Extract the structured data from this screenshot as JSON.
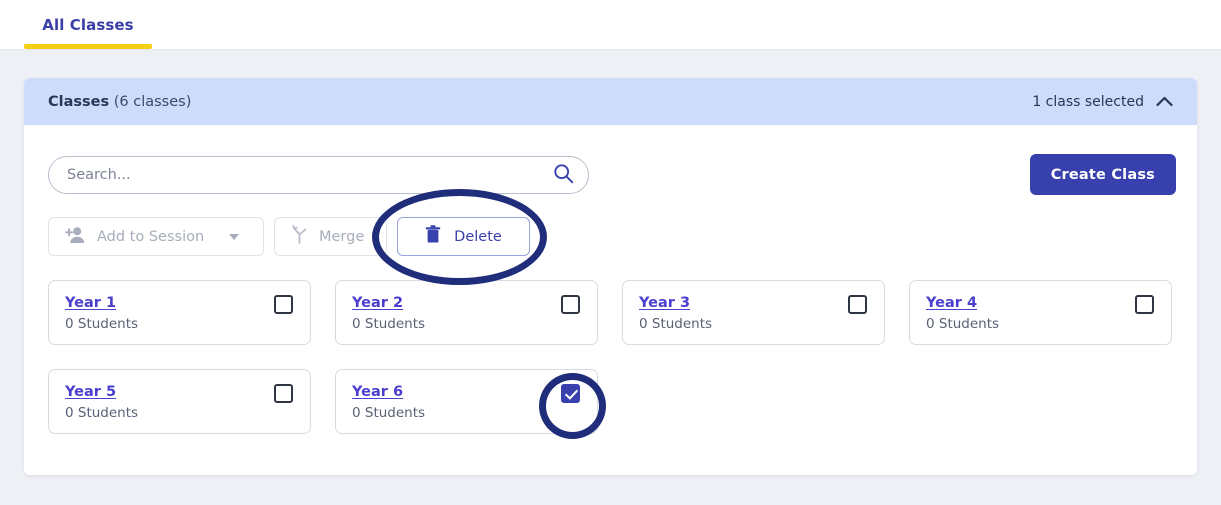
{
  "tabs": [
    {
      "label": "All Classes",
      "active": true
    }
  ],
  "panel": {
    "title": "Classes",
    "count_label": "(6 classes)",
    "selection_status": "1 class selected",
    "collapse_icon": "chevron-up-icon"
  },
  "search": {
    "placeholder": "Search...",
    "value": "",
    "icon": "search-icon"
  },
  "create_button": {
    "label": "Create Class"
  },
  "toolbar": {
    "add_to_session": {
      "label": "Add to Session",
      "icon": "person-add-icon",
      "caret": "caret-down-icon",
      "disabled": true
    },
    "merge": {
      "label": "Merge",
      "icon": "merge-icon",
      "disabled": true
    },
    "delete": {
      "label": "Delete",
      "icon": "trash-icon",
      "disabled": false
    }
  },
  "classes": [
    {
      "name": "Year 1",
      "students": "0 Students",
      "checked": false
    },
    {
      "name": "Year 2",
      "students": "0 Students",
      "checked": false
    },
    {
      "name": "Year 3",
      "students": "0 Students",
      "checked": false
    },
    {
      "name": "Year 4",
      "students": "0 Students",
      "checked": false
    },
    {
      "name": "Year 5",
      "students": "0 Students",
      "checked": false
    },
    {
      "name": "Year 6",
      "students": "0 Students",
      "checked": true
    }
  ],
  "annotations": [
    {
      "target": "delete-button",
      "shape": "ellipse",
      "color": "#1f2d7a"
    },
    {
      "target": "class-checkbox-year-6",
      "shape": "circle",
      "color": "#1f2d7a"
    }
  ],
  "colors": {
    "accent": "#3840ad",
    "tab_underline": "#f5cf16",
    "panel_header_bg": "#ccdcfa",
    "link": "#4b3fcf",
    "page_bg": "#eef0f5",
    "annotation": "#1f2d7a"
  }
}
